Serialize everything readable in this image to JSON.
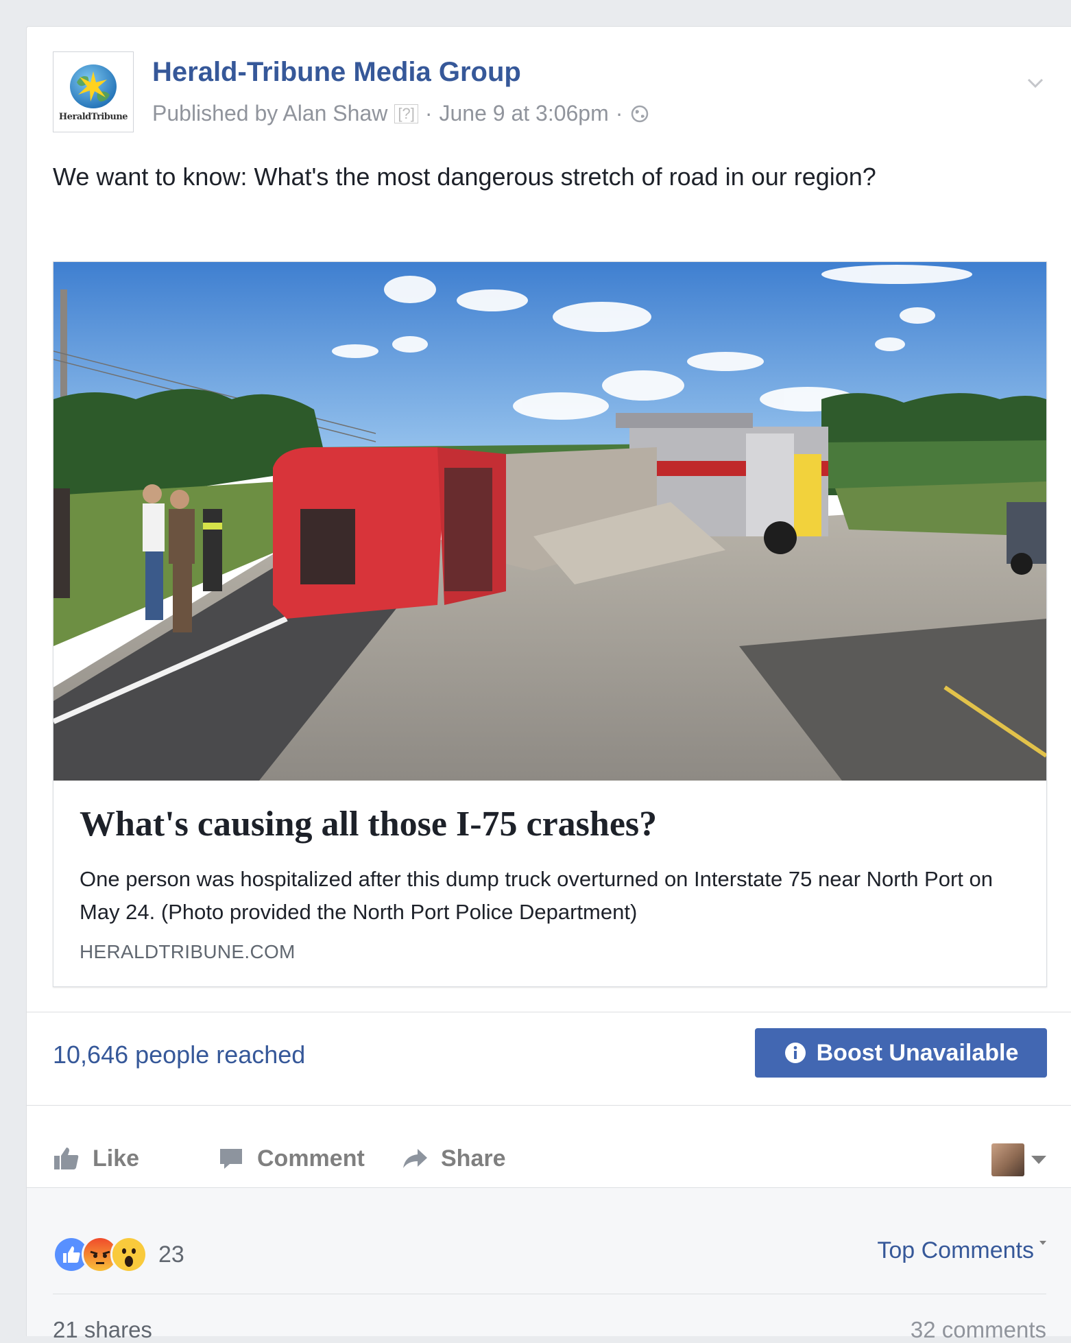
{
  "post": {
    "page_name": "Herald-Tribune Media Group",
    "logo_wordmark": "HeraldTribune",
    "published_by": "Published by Alan Shaw",
    "help_marker": "[?]",
    "separator": "·",
    "timestamp": "June 9 at 3:06pm",
    "privacy_icon": "globe-icon",
    "menu_icon": "chevron-down-icon",
    "text": "We want to know: What's the most dangerous stretch of road in our region?"
  },
  "link_preview": {
    "image_icon": "overturned-dump-truck-photo",
    "title": "What's causing all those I-75 crashes?",
    "description": "One person was hospitalized after this dump truck overturned on Interstate 75 near North Port on May 24. (Photo provided the North Port Police Department)",
    "domain": "HERALDTRIBUNE.COM"
  },
  "insights": {
    "reach": "10,646 people reached",
    "boost_label": "Boost Unavailable",
    "boost_icon": "info-icon",
    "boost_color": "#4267b2"
  },
  "actions": {
    "like": "Like",
    "comment": "Comment",
    "share": "Share",
    "like_icon": "thumbs-up-icon",
    "comment_icon": "speech-bubble-icon",
    "share_icon": "share-arrow-icon"
  },
  "footer": {
    "reactions": [
      "like",
      "angry",
      "wow"
    ],
    "reaction_count": "23",
    "sort_label": "Top Comments",
    "shares": "21 shares",
    "comments": "32 comments"
  },
  "colors": {
    "link_blue": "#365899",
    "muted_gray": "#90949c",
    "background": "#e9ebee"
  }
}
